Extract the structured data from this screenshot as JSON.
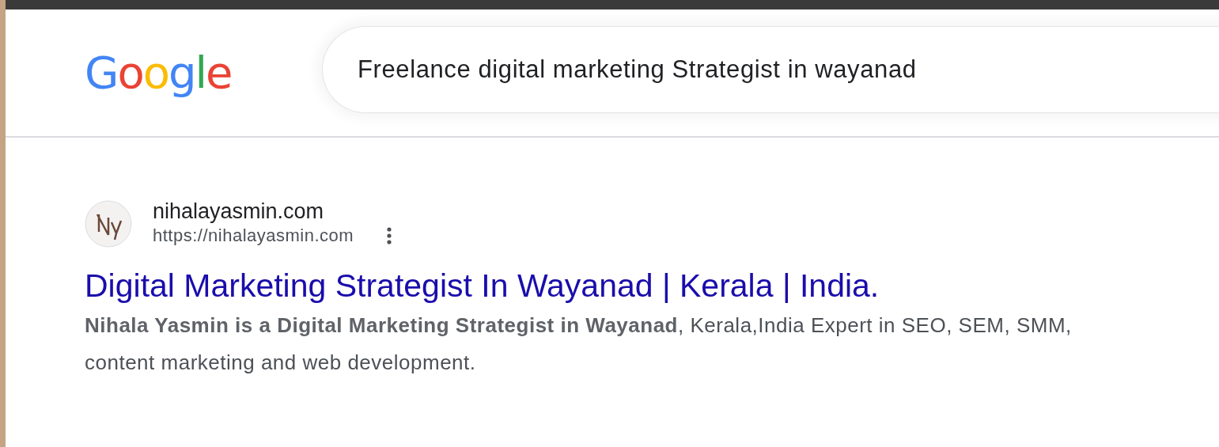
{
  "logo": [
    {
      "letter": "G",
      "color": "#4285f4"
    },
    {
      "letter": "o",
      "color": "#ea4335"
    },
    {
      "letter": "o",
      "color": "#fbbc05"
    },
    {
      "letter": "g",
      "color": "#4285f4"
    },
    {
      "letter": "l",
      "color": "#34a853"
    },
    {
      "letter": "e",
      "color": "#ea4335"
    }
  ],
  "search": {
    "value": "Freelance digital marketing Strategist in wayanad"
  },
  "results": [
    {
      "site_name": "nihalayasmin.com",
      "url": "https://nihalayasmin.com",
      "title": "Digital Marketing Strategist In Wayanad | Kerala | India.",
      "snippet": "**Nihala Yasmin is a Digital Marketing  Strategist in Wayanad**, Kerala,India Expert in SEO, SEM, SMM, content marketing and web development."
    }
  ]
}
